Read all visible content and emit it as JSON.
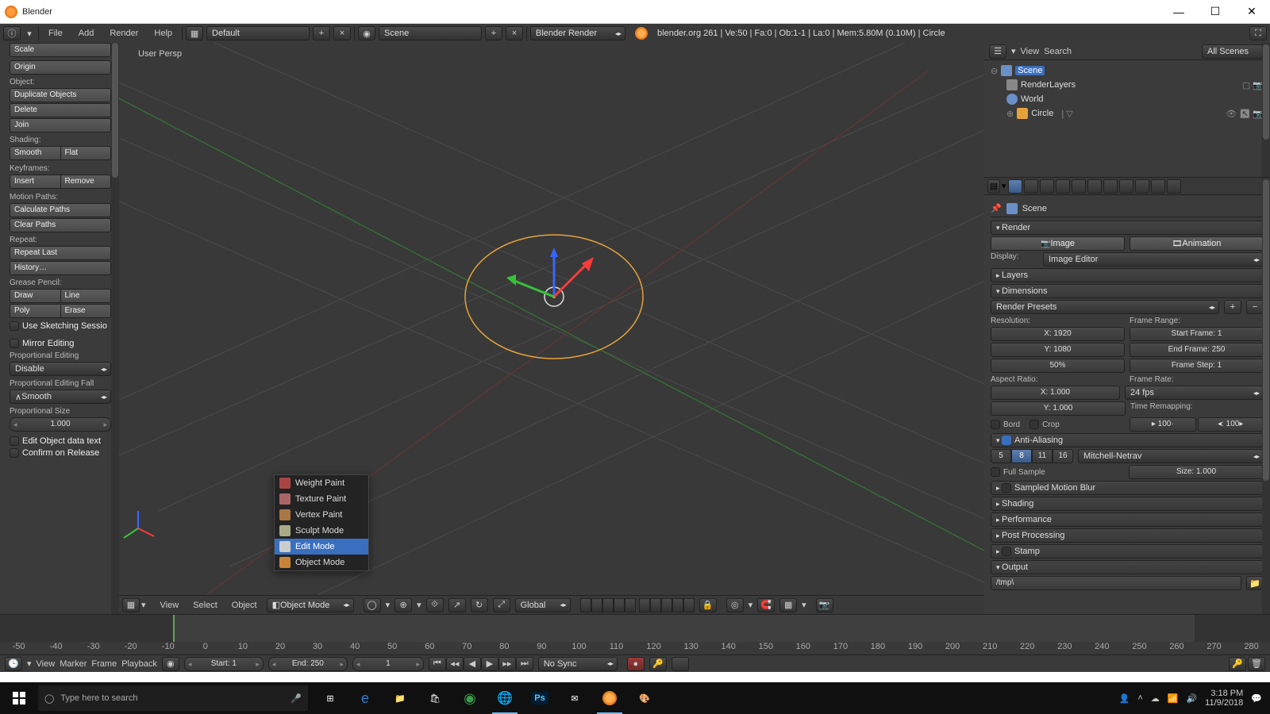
{
  "title": "Blender",
  "menus": [
    "File",
    "Add",
    "Render",
    "Help"
  ],
  "layout_name": "Default",
  "scene_name": "Scene",
  "engine": "Blender Render",
  "status": "blender.org 261 | Ve:50 | Fa:0 | Ob:1-1 | La:0 | Mem:5.80M (0.10M) | Circle",
  "view_label": "User Persp",
  "toolbox": {
    "scale": "Scale",
    "origin": "Origin",
    "obj_label": "Object:",
    "dup": "Duplicate Objects",
    "del": "Delete",
    "join": "Join",
    "shading_label": "Shading:",
    "smooth": "Smooth",
    "flat": "Flat",
    "kf_label": "Keyframes:",
    "insert": "Insert",
    "remove": "Remove",
    "mp_label": "Motion Paths:",
    "calc": "Calculate Paths",
    "clear": "Clear Paths",
    "rep_label": "Repeat:",
    "replast": "Repeat Last",
    "hist": "History…",
    "gp_label": "Grease Pencil:",
    "draw": "Draw",
    "line": "Line",
    "poly": "Poly",
    "erase": "Erase",
    "sketch": "Use Sketching Sessio",
    "mirror": "Mirror Editing",
    "pe_label": "Proportional Editing",
    "pe_mode": "Disable",
    "pef_label": "Proportional Editing Fall",
    "pef_mode": "Smooth",
    "ps_label": "Proportional Size",
    "ps_val": "1.000",
    "editdata": "Edit Object data text",
    "confirm": "Confirm on Release"
  },
  "modes": [
    "Weight Paint",
    "Texture Paint",
    "Vertex Paint",
    "Sculpt Mode",
    "Edit Mode",
    "Object Mode"
  ],
  "mode_selected": "Edit Mode",
  "vp_menus": [
    "View",
    "Select",
    "Object"
  ],
  "vp_mode": "Object Mode",
  "vp_orient": "Global",
  "outliner": {
    "menus": [
      "View",
      "Search"
    ],
    "filter": "All Scenes",
    "root": "Scene",
    "rl": "RenderLayers",
    "world": "World",
    "circle": "Circle"
  },
  "props": {
    "crumb": "Scene",
    "render_hdr": "Render",
    "image": "Image",
    "anim": "Animation",
    "display": "Display:",
    "display_val": "Image Editor",
    "layers": "Layers",
    "dims": "Dimensions",
    "presets": "Render Presets",
    "res": "Resolution:",
    "xr": "X: 1920",
    "yr": "Y: 1080",
    "pct": "50%",
    "fr": "Frame Range:",
    "sf": "Start Frame: 1",
    "ef": "End Frame: 250",
    "fs": "Frame Step: 1",
    "ar": "Aspect Ratio:",
    "xa": "X: 1.000",
    "ya": "Y: 1.000",
    "frate": "Frame Rate:",
    "fps": "24 fps",
    "trm": "Time Remapping:",
    "old": "▸ 100·",
    "new": "◂: 100▸",
    "bord": "Bord",
    "crop": "Crop",
    "aa": "Anti-Aliasing",
    "aa_levels": [
      "5",
      "8",
      "11",
      "16"
    ],
    "aa_sel": "8",
    "aa_filter": "Mitchell-Netrav",
    "fullsample": "Full Sample",
    "size": "Size: 1.000",
    "smb": "Sampled Motion Blur",
    "shading": "Shading",
    "perf": "Performance",
    "pp": "Post Processing",
    "stamp": "Stamp",
    "output": "Output",
    "outpath": "/tmp\\"
  },
  "timeline": {
    "menus": [
      "View",
      "Marker",
      "Frame",
      "Playback"
    ],
    "start": "Start: 1",
    "end": "End: 250",
    "cur": "1",
    "sync": "No Sync",
    "ticks": [
      "-50",
      "-40",
      "-30",
      "-20",
      "-10",
      "0",
      "10",
      "20",
      "30",
      "40",
      "50",
      "60",
      "70",
      "80",
      "90",
      "100",
      "110",
      "120",
      "130",
      "140",
      "150",
      "160",
      "170",
      "180",
      "190",
      "200",
      "210",
      "220",
      "230",
      "240",
      "250",
      "260",
      "270",
      "280"
    ]
  },
  "task": {
    "search": "Type here to search",
    "time": "3:18 PM",
    "date": "11/9/2018"
  }
}
